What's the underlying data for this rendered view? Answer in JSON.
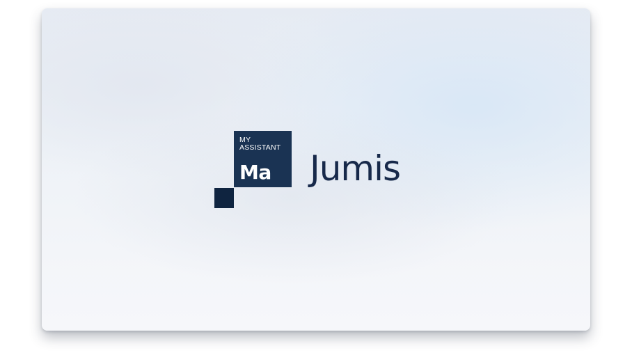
{
  "logo": {
    "caption_line1": "MY",
    "caption_line2": "ASSISTANT",
    "abbr": "Ma"
  },
  "brand": {
    "name": "Jumis"
  },
  "colors": {
    "logo_box": "#1a3353",
    "logo_small_square": "#0f2440",
    "brand_text": "#17294a",
    "background": "#eef2f7"
  }
}
